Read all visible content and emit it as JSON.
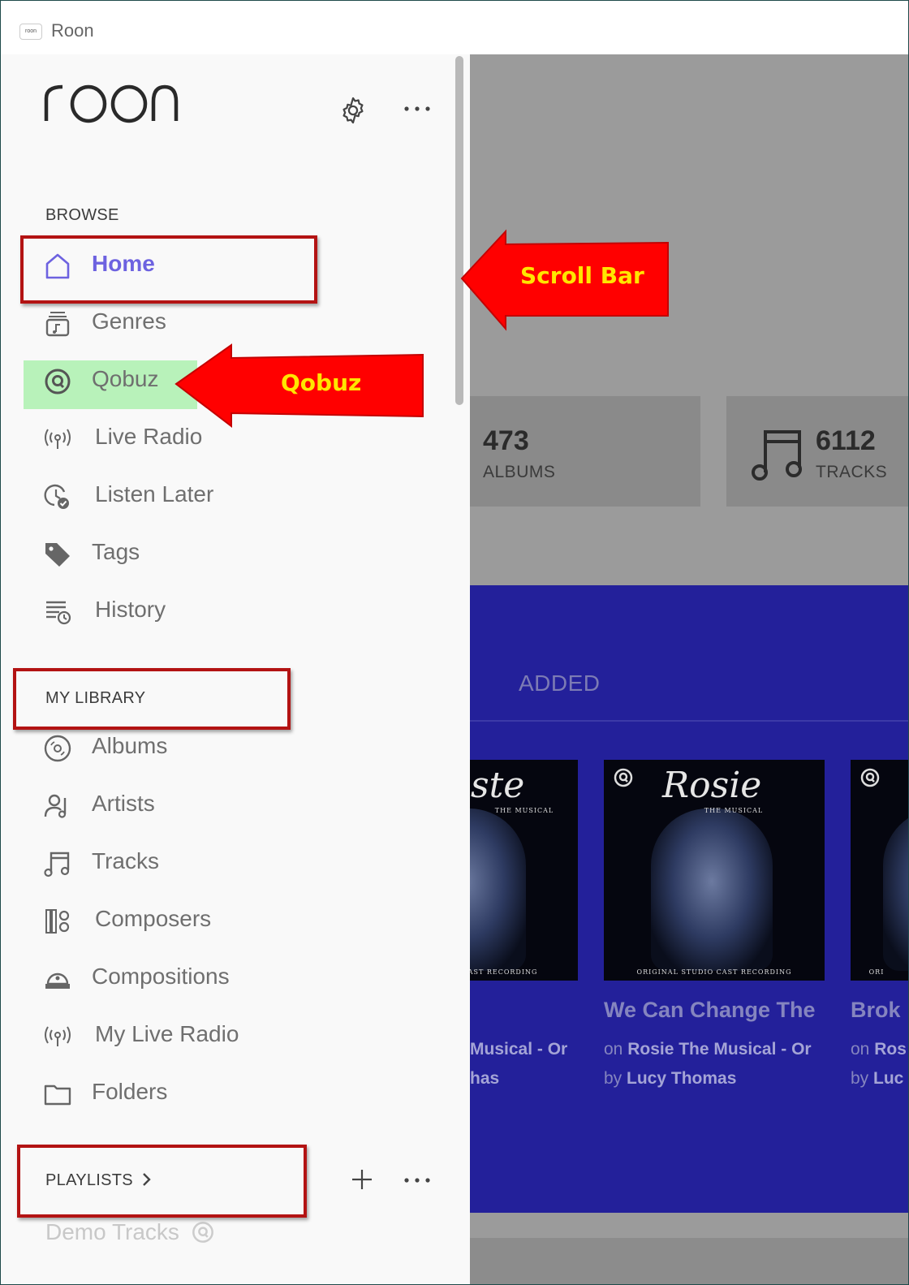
{
  "window": {
    "app_badge": "roon",
    "title": "Roon"
  },
  "sidebar": {
    "logo": "roon",
    "settings_icon": "gear-icon",
    "more_icon": "more-icon",
    "browse_header": "BROWSE",
    "browse_items": [
      {
        "label": "Home",
        "icon": "home-icon",
        "active": true
      },
      {
        "label": "Genres",
        "icon": "genres-icon"
      },
      {
        "label": "Qobuz",
        "icon": "qobuz-icon",
        "highlight": "#b8f2ba"
      },
      {
        "label": "Live Radio",
        "icon": "radio-icon"
      },
      {
        "label": "Listen Later",
        "icon": "listen-later-icon"
      },
      {
        "label": "Tags",
        "icon": "tag-icon"
      },
      {
        "label": "History",
        "icon": "history-icon"
      }
    ],
    "library_header": "MY LIBRARY",
    "library_items": [
      {
        "label": "Albums",
        "icon": "album-icon"
      },
      {
        "label": "Artists",
        "icon": "artist-icon"
      },
      {
        "label": "Tracks",
        "icon": "music-note-icon"
      },
      {
        "label": "Composers",
        "icon": "composer-icon"
      },
      {
        "label": "Compositions",
        "icon": "composition-icon"
      },
      {
        "label": "My Live Radio",
        "icon": "radio-icon"
      },
      {
        "label": "Folders",
        "icon": "folder-icon"
      }
    ],
    "playlists_header": "PLAYLISTS",
    "playlists_chevron": "chevron-right-icon",
    "add_icon": "plus-icon",
    "playlist_items": [
      {
        "label": "Demo Tracks",
        "icon": "qobuz-icon"
      }
    ]
  },
  "content": {
    "stats": [
      {
        "value": "473",
        "label": "ALBUMS"
      },
      {
        "value": "6112",
        "label": "TRACKS"
      }
    ],
    "section_label": "ADDED",
    "cards": [
      {
        "title": "",
        "on_prefix": "",
        "album": "Musical - Or",
        "by_prefix": "",
        "artist": "has",
        "cover_script": "ste",
        "cover_sub": "THE MUSICAL",
        "cover_bottom": "CAST RECORDING"
      },
      {
        "title": "We Can Change The",
        "on_prefix": "on",
        "album": "Rosie The Musical - Or",
        "by_prefix": "by",
        "artist": "Lucy Thomas",
        "cover_script": "Rosie",
        "cover_sub": "THE MUSICAL",
        "cover_bottom": "ORIGINAL STUDIO CAST RECORDING"
      },
      {
        "title": "Brok",
        "on_prefix": "on",
        "album": "Ros",
        "by_prefix": "by",
        "artist": "Luc",
        "cover_script": "",
        "cover_sub": "",
        "cover_bottom": "ORI"
      }
    ]
  },
  "annotations": {
    "scroll_bar": "Scroll Bar",
    "qobuz": "Qobuz",
    "box_color": "#b31313",
    "arrow_color": "#ff0000",
    "arrow_text_color": "#ffe600"
  }
}
